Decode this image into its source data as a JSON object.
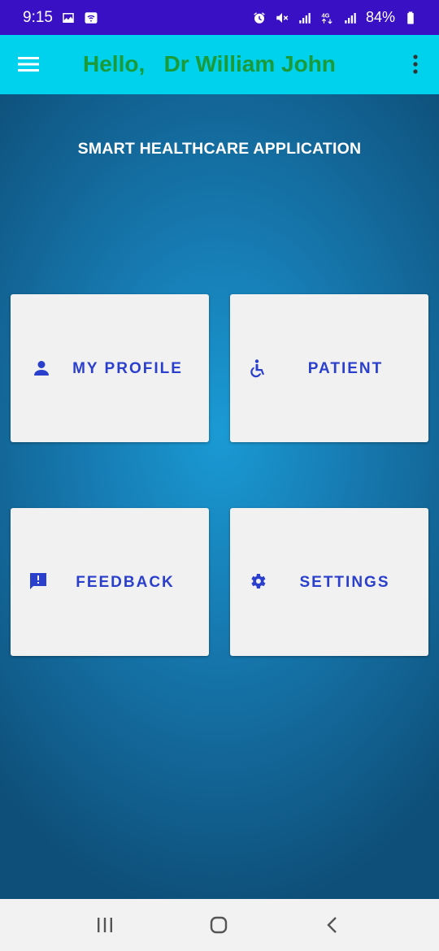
{
  "status_bar": {
    "time": "9:15",
    "battery": "84%",
    "left_icons": [
      "gallery-icon",
      "wifi-icon"
    ],
    "right_icons": [
      "alarm-icon",
      "mute-icon",
      "signal-icon",
      "4g-icon",
      "signal-icon",
      "battery-icon"
    ],
    "background_color": "#3a10c4"
  },
  "app_bar": {
    "greeting": "Hello,   Dr William John",
    "menu_icon": "hamburger-menu-icon",
    "more_icon": "more-vertical-icon",
    "background_color": "#00d2ee",
    "greeting_color": "#1b9a3a"
  },
  "main": {
    "title": "SMART HEALTHCARE APPLICATION",
    "tiles": [
      {
        "label": "MY PROFILE",
        "icon": "person-icon"
      },
      {
        "label": "PATIENT",
        "icon": "wheelchair-icon"
      },
      {
        "label": "FEEDBACK",
        "icon": "feedback-icon"
      },
      {
        "label": "SETTINGS",
        "icon": "gear-icon"
      }
    ],
    "tile_text_color": "#2a3fcc"
  },
  "nav_bar": {
    "buttons": [
      "recent-apps-icon",
      "home-icon",
      "back-icon"
    ]
  }
}
